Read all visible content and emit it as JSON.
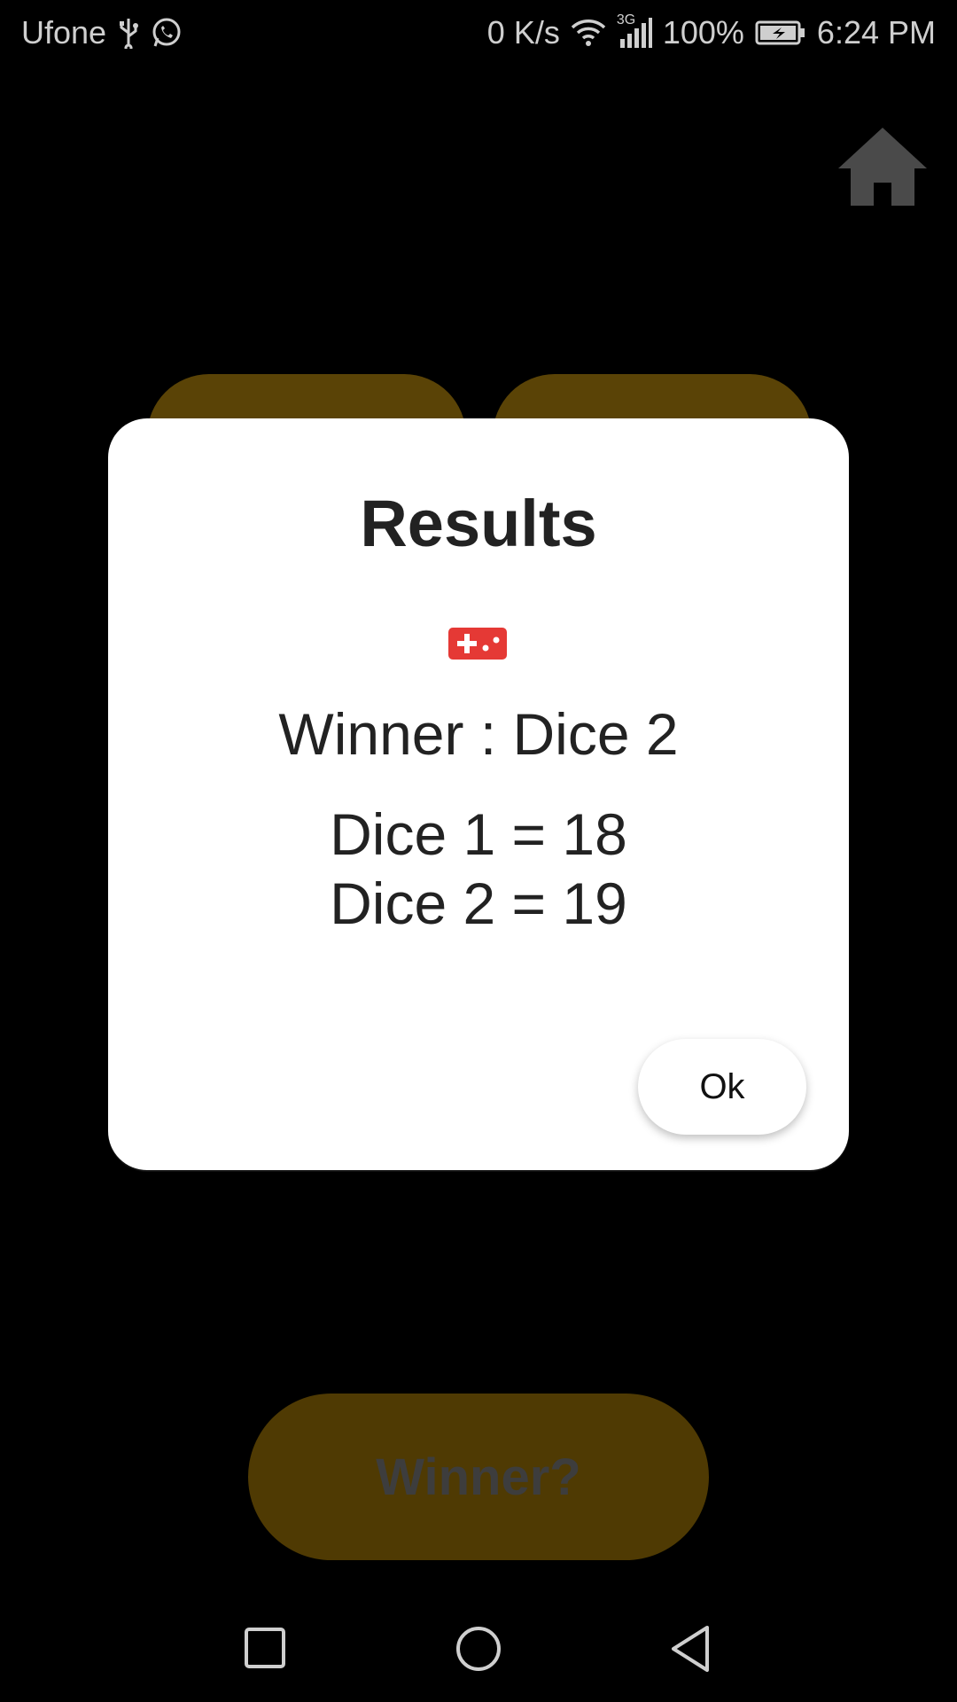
{
  "status": {
    "carrier": "Ufone",
    "speed": "0 K/s",
    "network": "3G",
    "battery": "100%",
    "time": "6:24 PM"
  },
  "bottom": {
    "winner_label": "Winner?"
  },
  "dialog": {
    "title": "Results",
    "icon": "gamepad-icon",
    "winner_text": "Winner : Dice 2",
    "score_1": "Dice 1 = 18",
    "score_2": "Dice 2 = 19",
    "ok_label": "Ok"
  },
  "colors": {
    "background": "#000000",
    "dialog": "#ffffff",
    "accent_dim": "#4f3a03",
    "icon_red": "#e53935"
  }
}
